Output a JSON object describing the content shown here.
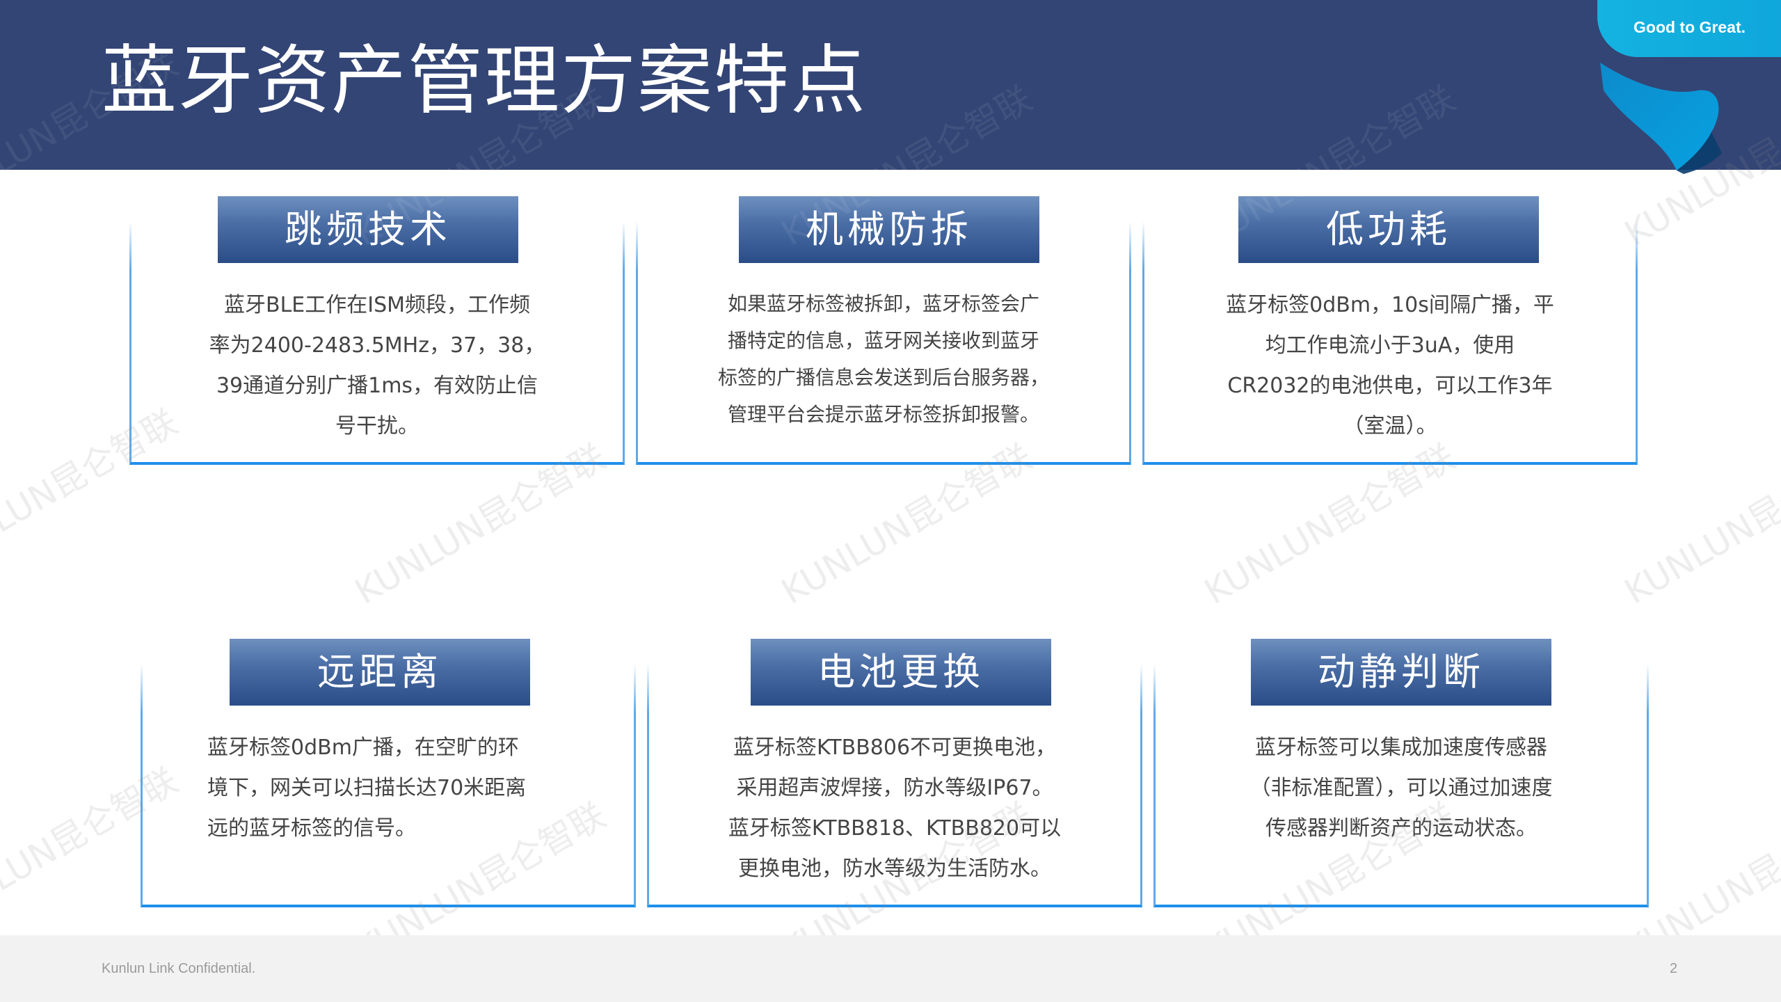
{
  "title": "蓝牙资产管理方案特点",
  "slogan": "Good to Great.",
  "watermark": "KUNLUN昆仑智联",
  "cards": [
    {
      "title": "跳频技术",
      "lines": [
        "蓝牙BLE工作在ISM频段，工作频",
        "率为2400-2483.5MHz，37，38，",
        "39通道分别广播1ms，有效防止信",
        "号干扰。"
      ]
    },
    {
      "title": "机械防拆",
      "lines": [
        "如果蓝牙标签被拆卸，蓝牙标签会广",
        "播特定的信息，蓝牙网关接收到蓝牙",
        "标签的广播信息会发送到后台服务器，",
        "管理平台会提示蓝牙标签拆卸报警。"
      ]
    },
    {
      "title": "低功耗",
      "lines": [
        "蓝牙标签0dBm，10s间隔广播，平",
        "均工作电流小于3uA，使用",
        "CR2032的电池供电，可以工作3年",
        "（室温）。"
      ]
    },
    {
      "title": "远距离",
      "lines": [
        "蓝牙标签0dBm广播，在空旷的环",
        "境下，网关可以扫描长达70米距离",
        "远的蓝牙标签的信号。"
      ]
    },
    {
      "title": "电池更换",
      "lines": [
        "蓝牙标签KTBB806不可更换电池，",
        "采用超声波焊接，防水等级IP67。",
        "蓝牙标签KTBB818、KTBB820可以",
        "更换电池，防水等级为生活防水。"
      ]
    },
    {
      "title": "动静判断",
      "lines": [
        "蓝牙标签可以集成加速度传感器",
        "（非标准配置），可以通过加速度",
        "传感器判断资产的运动状态。"
      ]
    }
  ],
  "footer": {
    "text": "Kunlun Link Confidential.",
    "page": "2"
  },
  "colors": {
    "header": "#334575",
    "accent": "#1e8fea",
    "slogan_bg": "#14b3e0"
  }
}
